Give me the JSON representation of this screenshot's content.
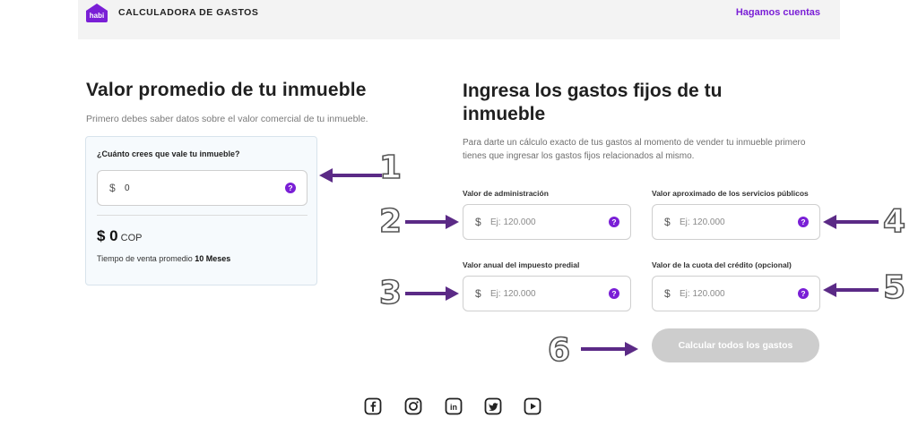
{
  "header": {
    "logo_text": "habi",
    "title": "CALCULADORA DE GASTOS",
    "link_label": "Hagamos cuentas"
  },
  "left": {
    "title": "Valor promedio de tu inmueble",
    "subtitle": "Primero debes saber datos sobre el valor comercial de tu inmueble.",
    "card": {
      "question": "¿Cuánto crees que vale tu inmueble?",
      "currency_symbol": "$",
      "input_value": "0",
      "amount": "$ 0",
      "currency": "COP",
      "time_label": "Tiempo de venta promedio",
      "time_value": "10 Meses"
    }
  },
  "right": {
    "title": "Ingresa los gastos fijos de tu inmueble",
    "description": "Para darte un cálculo exacto de tus gastos al momento de vender tu inmueble primero tienes que ingresar los gastos fijos relacionados al mismo.",
    "fields": [
      {
        "label": "Valor de administración",
        "placeholder": "Ej: 120.000"
      },
      {
        "label": "Valor aproximado de los servicios públicos",
        "placeholder": "Ej: 120.000"
      },
      {
        "label": "Valor anual del impuesto predial",
        "placeholder": "Ej: 120.000"
      },
      {
        "label": "Valor de la cuota del crédito (opcional)",
        "placeholder": "Ej: 120.000"
      }
    ],
    "currency_symbol": "$",
    "help_glyph": "?",
    "button_label": "Calcular todos los gastos"
  },
  "annotations": [
    "1",
    "2",
    "3",
    "4",
    "5",
    "6"
  ],
  "social_icons": [
    "facebook-icon",
    "instagram-icon",
    "linkedin-icon",
    "twitter-icon",
    "youtube-icon"
  ],
  "colors": {
    "accent": "#7a1fd6",
    "disabled_button": "#cdcdcd",
    "arrow": "#5b2a86",
    "card_bg": "#f6fafd"
  }
}
